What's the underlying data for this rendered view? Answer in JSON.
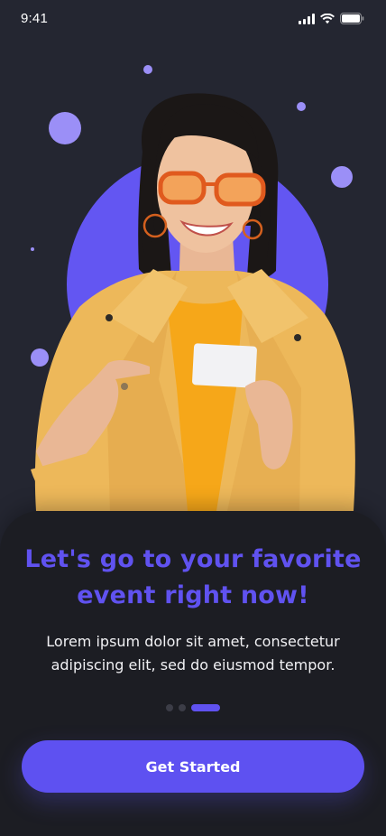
{
  "status_bar": {
    "time": "9:41",
    "icons": [
      "signal-icon",
      "wifi-icon",
      "battery-icon"
    ]
  },
  "hero": {
    "image": "woman-in-yellow-jacket-holding-card",
    "accent_color": "#6356f2"
  },
  "onboarding": {
    "title": "Let's go to your favorite event right now!",
    "body": "Lorem ipsum dolor sit amet, consectetur adipiscing elit, sed do eiusmod tempor.",
    "page_count": 3,
    "active_page": 3
  },
  "cta": {
    "label": "Get Started"
  },
  "colors": {
    "background": "#242631",
    "card": "#1c1d23",
    "primary": "#5e51f1",
    "title": "#6052f0",
    "text": "#f1f1f4"
  }
}
